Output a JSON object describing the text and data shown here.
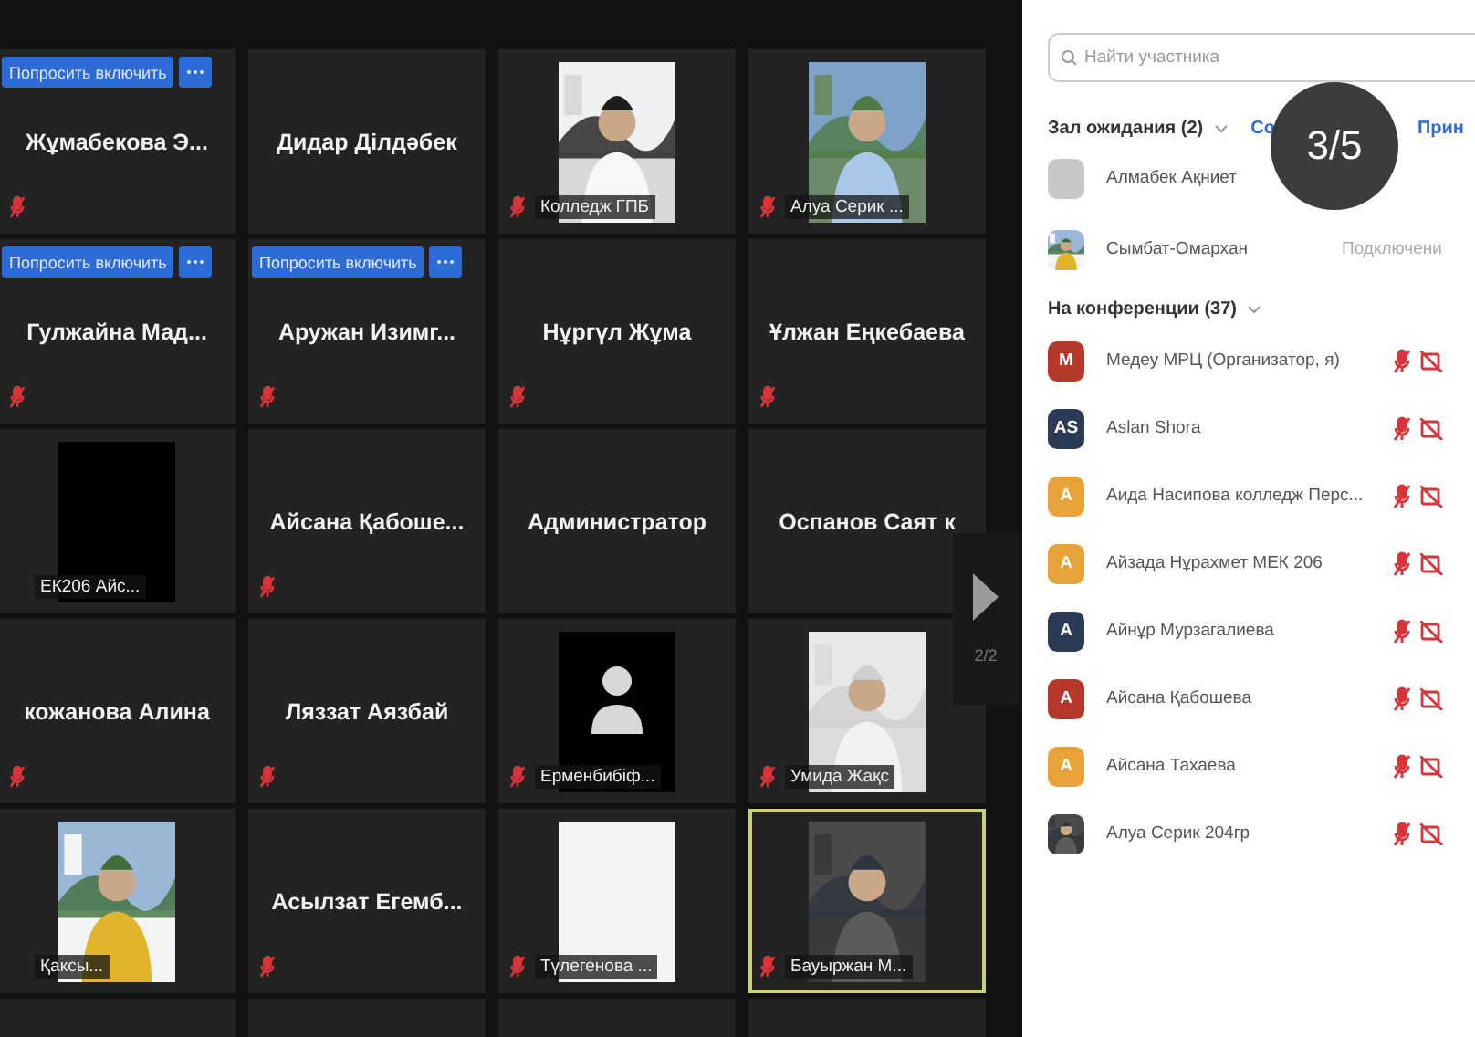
{
  "tiles": [
    {
      "kind": "name",
      "name": "Жұмабекова Э...",
      "ask_button": "Попросить включить",
      "muted": true,
      "speaking": false
    },
    {
      "kind": "name",
      "name": "Дидар Ділдәбек",
      "muted": false,
      "speaking": false
    },
    {
      "kind": "video",
      "name": "Колледж ГПБ",
      "muted": true,
      "speaking": false
    },
    {
      "kind": "video",
      "name": "Алуа Серик ...",
      "muted": true,
      "speaking": false
    },
    {
      "kind": "name",
      "name": "Гулжайна  Мад...",
      "ask_button": "Попросить включить",
      "muted": true,
      "speaking": false
    },
    {
      "kind": "name",
      "name": "Аружан  Изимг...",
      "ask_button": "Попросить включить",
      "muted": true,
      "speaking": false
    },
    {
      "kind": "name",
      "name": "Нұргүл Жұма",
      "muted": true,
      "speaking": false
    },
    {
      "kind": "name",
      "name": "Ұлжан Еңкебаева",
      "muted": true,
      "speaking": false
    },
    {
      "kind": "dark",
      "name": "ЕК206 Айс...",
      "muted": false,
      "speaking": false
    },
    {
      "kind": "name",
      "name": "Айсана Қабоше...",
      "muted": true,
      "speaking": false
    },
    {
      "kind": "name",
      "name": "Администратор",
      "muted": false,
      "speaking": false
    },
    {
      "kind": "name",
      "name": "Оспанов  Саят к",
      "muted": false,
      "speaking": false
    },
    {
      "kind": "name",
      "name": "кожанова Алина",
      "muted": true,
      "speaking": false
    },
    {
      "kind": "name",
      "name": "Ляззат Аязбай",
      "muted": true,
      "speaking": false
    },
    {
      "kind": "avatar",
      "name": "Ерменбибіф...",
      "muted": true,
      "speaking": false
    },
    {
      "kind": "video",
      "name": "Умида Жақс",
      "muted": true,
      "speaking": false
    },
    {
      "kind": "video",
      "name": "Қаксы...",
      "muted": false,
      "speaking": false
    },
    {
      "kind": "name",
      "name": "Асылзат  Егемб...",
      "muted": true,
      "speaking": false
    },
    {
      "kind": "blank",
      "name": "Түлегенова ...",
      "muted": true,
      "speaking": false
    },
    {
      "kind": "video",
      "name": "Бауыржан М...",
      "muted": true,
      "speaking": true
    }
  ],
  "pager": {
    "label": "2/2"
  },
  "page_counter": "3/5",
  "panel": {
    "search": {
      "placeholder": "Найти участника"
    },
    "waiting": {
      "title": "Зал ожидания (2)",
      "links": [
        "Со",
        "Прин"
      ],
      "items": [
        {
          "name": "Алмабек Ақниет",
          "kind": "gray"
        },
        {
          "name": "Сымбат-Омархан",
          "status": "Подключени"
        }
      ]
    },
    "conference": {
      "title": "На конференции (37)",
      "items": [
        {
          "initials": "M",
          "color": "#b5382a",
          "name": "Медеу МРЦ (Организатор, я)"
        },
        {
          "initials": "AS",
          "color": "#2b3a55",
          "name": "Aslan Shora"
        },
        {
          "initials": "A",
          "color": "#e8a23a",
          "name": "Аида  Насипова колледж Перс..."
        },
        {
          "initials": "A",
          "color": "#e8a23a",
          "name": "Айзада Нұрахмет МЕК 206"
        },
        {
          "initials": "A",
          "color": "#2b3a55",
          "name": "Айнұр Мурзагалиева"
        },
        {
          "initials": "A",
          "color": "#b5382a",
          "name": "Айсана Қабошева"
        },
        {
          "initials": "A",
          "color": "#e8a23a",
          "name": "Айсана Тахаева"
        },
        {
          "name": "Алуа Серик 204гр"
        }
      ]
    }
  }
}
